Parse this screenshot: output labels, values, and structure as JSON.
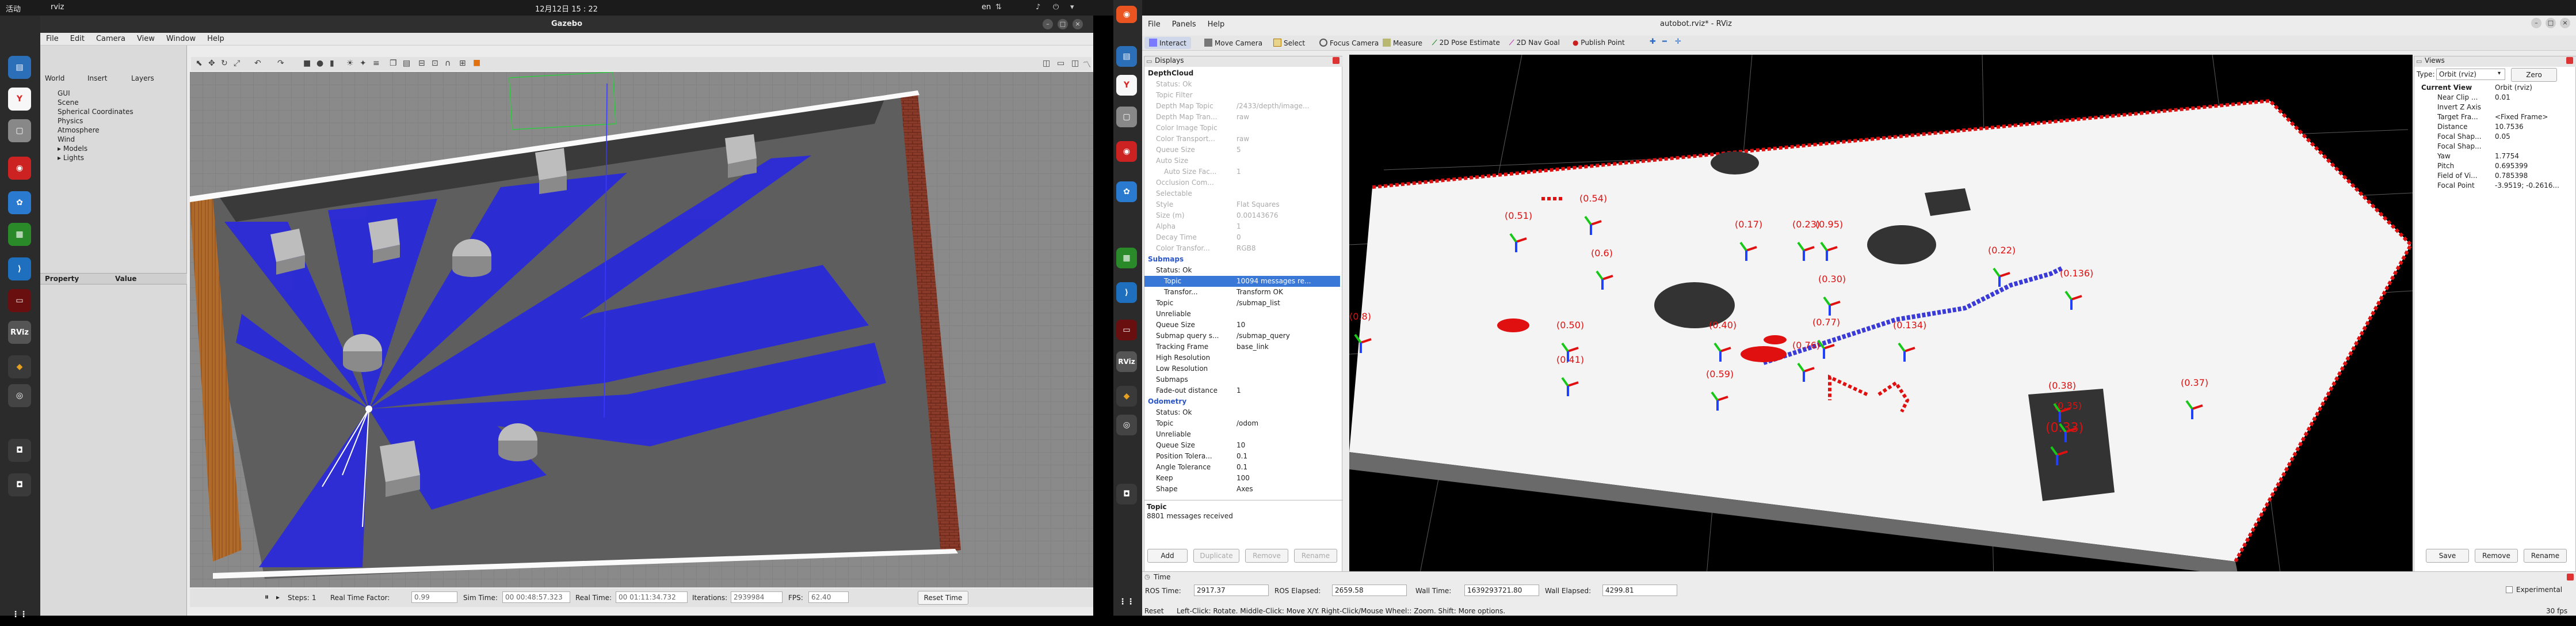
{
  "topbar": {
    "activities": "活动",
    "app": "rviz",
    "clock": "12月12日  15 : 22",
    "lang": "en",
    "tray_icons": [
      "network-icon",
      "volume-icon",
      "power-icon",
      "menu-icon"
    ]
  },
  "gazebo": {
    "title": "Gazebo",
    "menu": [
      "File",
      "Edit",
      "Camera",
      "View",
      "Window",
      "Help"
    ],
    "tabs": [
      "World",
      "Insert",
      "Layers"
    ],
    "tree": [
      "GUI",
      "Scene",
      "Spherical Coordinates",
      "Physics",
      "Atmosphere",
      "Wind",
      "Models",
      "Lights"
    ],
    "prop_headers": [
      "Property",
      "Value"
    ],
    "status": {
      "steps_label": "Steps:",
      "steps_value": "1",
      "rtf_label": "Real Time Factor:",
      "rtf_value": "0.99",
      "sim_label": "Sim Time:",
      "sim_value": "00 00:48:57.323",
      "real_label": "Real Time:",
      "real_value": "00 01:11:34.732",
      "iter_label": "Iterations:",
      "iter_value": "2939984",
      "fps_label": "FPS:",
      "fps_value": "62.40",
      "reset": "Reset Time"
    }
  },
  "rviz": {
    "title": "autobot.rviz* - RViz",
    "menu": [
      "File",
      "Panels",
      "Help"
    ],
    "tools": [
      "Interact",
      "Move Camera",
      "Select",
      "Focus Camera",
      "Measure",
      "2D Pose Estimate",
      "2D Nav Goal",
      "Publish Point"
    ],
    "tool_colors": [
      "#7a7aff",
      "#777777",
      "#b07a00",
      "#555555",
      "#6a6a00",
      "#2a8a2a",
      "#2a6ac8",
      "#c81e1e"
    ],
    "displays_title": "Displays",
    "displays": [
      {
        "k": "DepthCloud",
        "v": "",
        "bold": true,
        "dim": false,
        "indent": 0
      },
      {
        "k": "Status: Ok",
        "v": "",
        "dim": true,
        "indent": 1
      },
      {
        "k": "Topic Filter",
        "v": "",
        "dim": true,
        "indent": 1
      },
      {
        "k": "Depth Map Topic",
        "v": "/2433/depth/image...",
        "dim": true,
        "indent": 1
      },
      {
        "k": "Depth Map Tran...",
        "v": "raw",
        "dim": true,
        "indent": 1
      },
      {
        "k": "Color Image Topic",
        "v": "",
        "dim": true,
        "indent": 1
      },
      {
        "k": "Color Transport...",
        "v": "raw",
        "dim": true,
        "indent": 1
      },
      {
        "k": "Queue Size",
        "v": "5",
        "dim": true,
        "indent": 1
      },
      {
        "k": "Auto Size",
        "v": "",
        "dim": true,
        "indent": 1
      },
      {
        "k": "Auto Size Fac...",
        "v": "1",
        "dim": true,
        "indent": 2
      },
      {
        "k": "Occlusion Com...",
        "v": "",
        "dim": true,
        "indent": 1
      },
      {
        "k": "Selectable",
        "v": "",
        "dim": true,
        "indent": 1
      },
      {
        "k": "Style",
        "v": "Flat Squares",
        "dim": true,
        "indent": 1
      },
      {
        "k": "Size (m)",
        "v": "0.00143676",
        "dim": true,
        "indent": 1
      },
      {
        "k": "Alpha",
        "v": "1",
        "dim": true,
        "indent": 1
      },
      {
        "k": "Decay Time",
        "v": "0",
        "dim": true,
        "indent": 1
      },
      {
        "k": "Color Transfor...",
        "v": "RGB8",
        "dim": true,
        "indent": 1
      },
      {
        "k": "Submaps",
        "v": "",
        "bold": true,
        "dim": false,
        "indent": 0,
        "blue": true
      },
      {
        "k": "Status: Ok",
        "v": "",
        "dim": false,
        "indent": 1
      },
      {
        "k": "Topic",
        "v": "10094 messages re...",
        "dim": false,
        "indent": 2,
        "selected": true
      },
      {
        "k": "Transfor...",
        "v": "Transform OK",
        "dim": false,
        "indent": 2
      },
      {
        "k": "Topic",
        "v": "/submap_list",
        "dim": false,
        "indent": 1
      },
      {
        "k": "Unreliable",
        "v": "",
        "dim": false,
        "indent": 1
      },
      {
        "k": "Queue Size",
        "v": "10",
        "dim": false,
        "indent": 1
      },
      {
        "k": "Submap query s...",
        "v": "/submap_query",
        "dim": false,
        "indent": 1
      },
      {
        "k": "Tracking Frame",
        "v": "base_link",
        "dim": false,
        "indent": 1
      },
      {
        "k": "High Resolution",
        "v": "",
        "dim": false,
        "indent": 1
      },
      {
        "k": "Low Resolution",
        "v": "",
        "dim": false,
        "indent": 1
      },
      {
        "k": "Submaps",
        "v": "",
        "dim": false,
        "indent": 1
      },
      {
        "k": "Fade-out distance",
        "v": "1",
        "dim": false,
        "indent": 1
      },
      {
        "k": "Odometry",
        "v": "",
        "bold": true,
        "dim": false,
        "indent": 0,
        "blue": true
      },
      {
        "k": "Status: Ok",
        "v": "",
        "dim": false,
        "indent": 1
      },
      {
        "k": "Topic",
        "v": "/odom",
        "dim": false,
        "indent": 1
      },
      {
        "k": "Unreliable",
        "v": "",
        "dim": false,
        "indent": 1
      },
      {
        "k": "Queue Size",
        "v": "10",
        "dim": false,
        "indent": 1
      },
      {
        "k": "Position Tolera...",
        "v": "0.1",
        "dim": false,
        "indent": 1
      },
      {
        "k": "Angle Tolerance",
        "v": "0.1",
        "dim": false,
        "indent": 1
      },
      {
        "k": "Keep",
        "v": "100",
        "dim": false,
        "indent": 1
      },
      {
        "k": "Shape",
        "v": "Axes",
        "dim": false,
        "indent": 1
      }
    ],
    "desc_title": "Topic",
    "desc_text": "8801 messages received",
    "display_buttons": [
      "Add",
      "Duplicate",
      "Remove",
      "Rename"
    ],
    "views": {
      "title": "Views",
      "type_label": "Type:",
      "type_value": "Orbit (rviz)",
      "zero": "Zero",
      "props": [
        {
          "k": "Current View",
          "v": "Orbit (rviz)"
        },
        {
          "k": "Near Clip ...",
          "v": "0.01"
        },
        {
          "k": "Invert Z Axis",
          "v": ""
        },
        {
          "k": "Target Fra...",
          "v": "<Fixed Frame>"
        },
        {
          "k": "Distance",
          "v": "10.7536"
        },
        {
          "k": "Focal Shap...",
          "v": "0.05"
        },
        {
          "k": "Focal Shap...",
          "v": ""
        },
        {
          "k": "Yaw",
          "v": "1.7754"
        },
        {
          "k": "Pitch",
          "v": "0.695399"
        },
        {
          "k": "Field of Vi...",
          "v": "0.785398"
        },
        {
          "k": "Focal Point",
          "v": "-3.9519; -0.2616..."
        }
      ],
      "buttons": [
        "Save",
        "Remove",
        "Rename"
      ]
    },
    "time": {
      "title": "Time",
      "ros_time_label": "ROS Time:",
      "ros_time": "2917.37",
      "ros_elapsed_label": "ROS Elapsed:",
      "ros_elapsed": "2659.58",
      "wall_time_label": "Wall Time:",
      "wall_time": "1639293721.80",
      "wall_elapsed_label": "Wall Elapsed:",
      "wall_elapsed": "4299.81",
      "experimental": "Experimental"
    },
    "hint_reset": "Reset",
    "hint": "Left-Click: Rotate. Middle-Click: Move X/Y. Right-Click/Mouse Wheel:: Zoom. Shift: More options.",
    "fps": "30 fps",
    "marker_labels": [
      "(0.51)",
      "(0.54)",
      "(0.50)",
      "(0.41)",
      "(0.40)",
      "(0.59)",
      "(0.30)",
      "(0.22)",
      "(0.136)",
      "(0.134)",
      "(0.76)",
      "(0.77)",
      "(0.33)",
      "(0.35)",
      "(0.38)",
      "(0.37)",
      "(0.8)",
      "(0.6)",
      "(0.17)",
      "(0.23)",
      "(0.95)"
    ]
  },
  "colors": {
    "accent": "#3a78d8",
    "marker_red": "#e01010",
    "scan_blue": "#2a2aff"
  }
}
